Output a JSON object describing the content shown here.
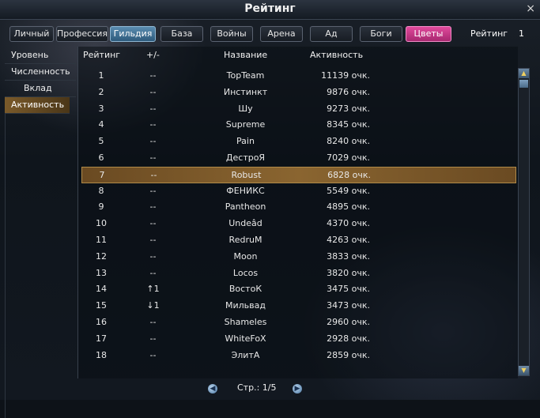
{
  "window": {
    "title": "Рейтинг",
    "close_icon": "×"
  },
  "tabs": [
    {
      "label": "Личный",
      "active": false
    },
    {
      "label": "Профессия",
      "active": false
    },
    {
      "label": "Гильдия",
      "active": true
    },
    {
      "label": "База",
      "active": false
    },
    {
      "label": "Войны",
      "active": false
    },
    {
      "label": "Арена",
      "active": false
    },
    {
      "label": "Ад",
      "active": false
    },
    {
      "label": "Боги",
      "active": false
    },
    {
      "label": "Цветы",
      "active": false
    }
  ],
  "rating": {
    "label": "Рейтинг",
    "value": "1"
  },
  "sidebar": {
    "items": [
      {
        "label": "Уровень"
      },
      {
        "label": "Численность"
      },
      {
        "label": "Вклад"
      },
      {
        "label": "Активность"
      }
    ],
    "active_index": 3
  },
  "table": {
    "headers": {
      "rank": "Рейтинг",
      "change": "+/-",
      "name": "Название",
      "activity": "Активность"
    },
    "highlight_index": 6,
    "rows": [
      {
        "rank": "1",
        "change": "--",
        "name": "TopTeam",
        "activity": "11139 очк."
      },
      {
        "rank": "2",
        "change": "--",
        "name": "Инстинкт",
        "activity": "9876 очк."
      },
      {
        "rank": "3",
        "change": "--",
        "name": "Шу",
        "activity": "9273 очк."
      },
      {
        "rank": "4",
        "change": "--",
        "name": "Supreme",
        "activity": "8345 очк."
      },
      {
        "rank": "5",
        "change": "--",
        "name": "Pain",
        "activity": "8240 очк."
      },
      {
        "rank": "6",
        "change": "--",
        "name": "ДестроЯ",
        "activity": "7029 очк."
      },
      {
        "rank": "7",
        "change": "--",
        "name": "Robust",
        "activity": "6828 очк."
      },
      {
        "rank": "8",
        "change": "--",
        "name": "ФЕНИКС",
        "activity": "5549 очк."
      },
      {
        "rank": "9",
        "change": "--",
        "name": "Pantheon",
        "activity": "4895 очк."
      },
      {
        "rank": "10",
        "change": "--",
        "name": "Undeâd",
        "activity": "4370 очк."
      },
      {
        "rank": "11",
        "change": "--",
        "name": "RedruM",
        "activity": "4263 очк."
      },
      {
        "rank": "12",
        "change": "--",
        "name": "Moon",
        "activity": "3833 очк."
      },
      {
        "rank": "13",
        "change": "--",
        "name": "Locos",
        "activity": "3820 очк."
      },
      {
        "rank": "14",
        "change": "↑1",
        "name": "ВостоК",
        "activity": "3475 очк."
      },
      {
        "rank": "15",
        "change": "↓1",
        "name": "Мильвад",
        "activity": "3473 очк."
      },
      {
        "rank": "16",
        "change": "--",
        "name": "Shameles",
        "activity": "2960 очк."
      },
      {
        "rank": "17",
        "change": "--",
        "name": "WhiteFoX",
        "activity": "2928 очк."
      },
      {
        "rank": "18",
        "change": "--",
        "name": "ЭлитА",
        "activity": "2859 очк."
      }
    ]
  },
  "pager": {
    "text": "Стр.: 1/5",
    "prev_icon": "◀",
    "next_icon": "▶"
  },
  "scrollbar": {
    "up_icon": "▲",
    "down_icon": "▼"
  },
  "colors": {
    "active_tab": "#4a7ca0",
    "pink_tab": "#d0408e",
    "highlight_row": "#8a6530"
  }
}
